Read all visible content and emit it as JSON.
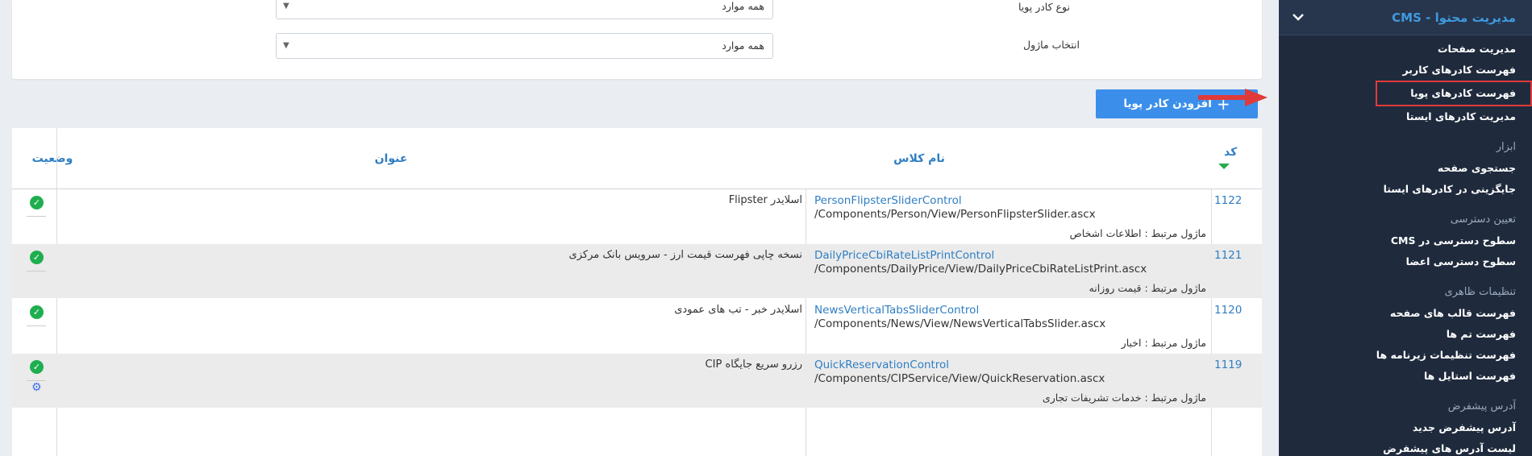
{
  "sidebar": {
    "header": "مدیریت محتوا - CMS",
    "items": [
      {
        "type": "item",
        "label": "مدیریت صفحات"
      },
      {
        "type": "item",
        "label": "فهرست کادرهای کاربر"
      },
      {
        "type": "item",
        "label": "فهرست کادرهای پویا",
        "active": true
      },
      {
        "type": "item",
        "label": "مدیریت کادرهای ایستا"
      },
      {
        "type": "group",
        "label": "ابزار"
      },
      {
        "type": "item",
        "label": "جستجوی صفحه"
      },
      {
        "type": "item",
        "label": "جایگزینی در کادرهای ایستا"
      },
      {
        "type": "group",
        "label": "تعیین دسترسی"
      },
      {
        "type": "item",
        "label": "سطوح دسترسی در CMS"
      },
      {
        "type": "item",
        "label": "سطوح دسترسی اعضا"
      },
      {
        "type": "group",
        "label": "تنظیمات ظاهری"
      },
      {
        "type": "item",
        "label": "فهرست قالب های صفحه"
      },
      {
        "type": "item",
        "label": "فهرست تم ها"
      },
      {
        "type": "item",
        "label": "فهرست تنظیمات زیرنامه ها"
      },
      {
        "type": "item",
        "label": "فهرست استایل ها"
      },
      {
        "type": "group",
        "label": "آدرس پیشفرض"
      },
      {
        "type": "item",
        "label": "آدرس پیشفرض جدید"
      },
      {
        "type": "item",
        "label": "لیست آدرس های پیشفرض"
      }
    ]
  },
  "filters": {
    "type_label": "نوع کادر پویا",
    "type_value": "همه موارد",
    "module_label": "انتخاب ماژول",
    "module_value": "همه موارد"
  },
  "add_button": {
    "label": "افزودن کادر پویا"
  },
  "table": {
    "headers": {
      "code": "کد",
      "class_name": "نام کلاس",
      "title": "عنوان",
      "status": "وضعیت"
    },
    "rows": [
      {
        "code": "1122",
        "class_name": "PersonFlipsterSliderControl",
        "path": "/Components/Person/View/PersonFlipsterSlider.ascx",
        "module": "ماژول مرتبط : اطلاعات اشخاص",
        "title": "اسلایدر Flipster",
        "status": "active",
        "settings": false
      },
      {
        "code": "1121",
        "class_name": "DailyPriceCbiRateListPrintControl",
        "path": "/Components/DailyPrice/View/DailyPriceCbiRateListPrint.ascx",
        "module": "ماژول مرتبط : قیمت روزانه",
        "title": "نسخه چاپی فهرست قیمت ارز - سرویس بانک مرکزی",
        "status": "active",
        "settings": false
      },
      {
        "code": "1120",
        "class_name": "NewsVerticalTabsSliderControl",
        "path": "/Components/News/View/NewsVerticalTabsSlider.ascx",
        "module": "ماژول مرتبط : اخبار",
        "title": "اسلایدر خبر - تب های عمودی",
        "status": "active",
        "settings": false
      },
      {
        "code": "1119",
        "class_name": "QuickReservationControl",
        "path": "/Components/CIPService/View/QuickReservation.ascx",
        "module": "ماژول مرتبط : خدمات تشریفات تجاری",
        "title": "رزرو سریع جایگاه CIP",
        "status": "active",
        "settings": true
      }
    ]
  },
  "colors": {
    "accent": "#3b8fea",
    "link": "#2f7ec3",
    "success": "#1eae4f",
    "sidebar_bg": "#1f2b3d",
    "highlight": "#e03a3a"
  }
}
